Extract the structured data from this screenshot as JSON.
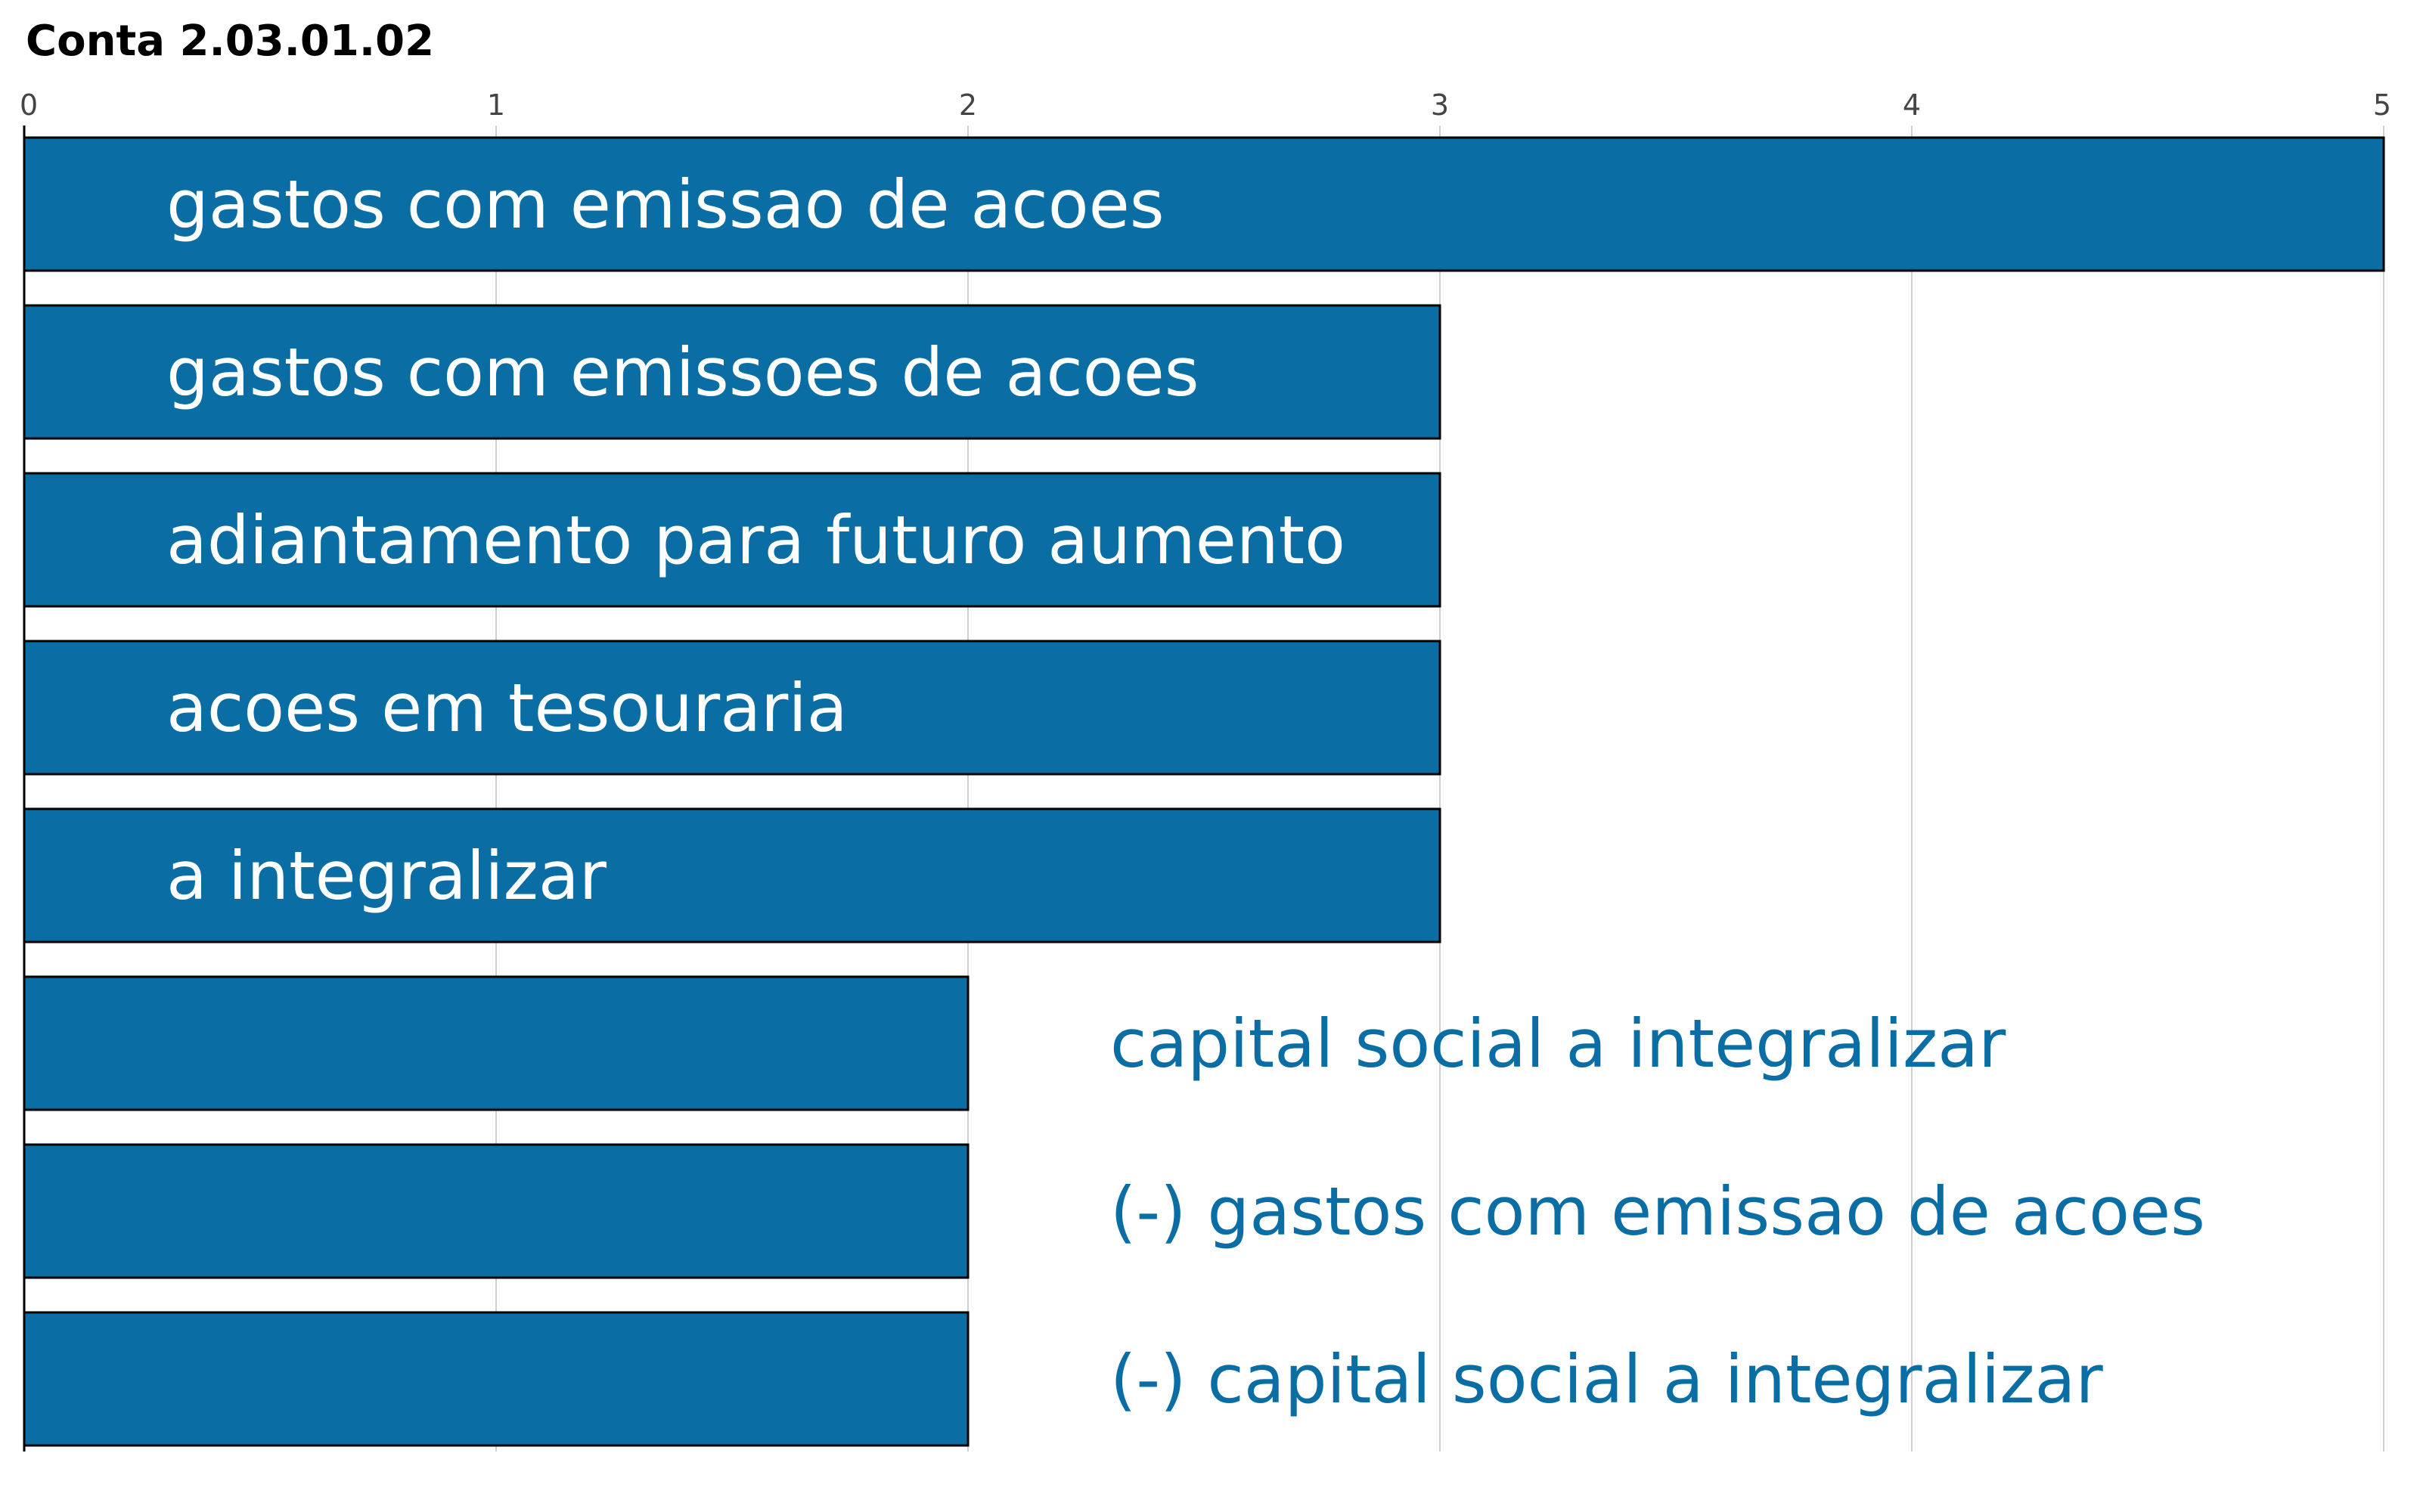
{
  "chart_data": {
    "type": "bar",
    "orientation": "horizontal",
    "title": "Conta 2.03.01.02",
    "xlabel": "",
    "ylabel": "",
    "xlim": [
      0,
      5
    ],
    "x_ticks": [
      0,
      1,
      2,
      3,
      4,
      5
    ],
    "grid": "vertical",
    "categories": [
      "gastos com emissao de acoes",
      "gastos com emissoes de acoes",
      "adiantamento para futuro aumento",
      "acoes em tesouraria",
      "a integralizar",
      "capital social a integralizar",
      "(-) gastos com emissao de acoes",
      "(-) capital social a integralizar"
    ],
    "values": [
      5,
      3,
      3,
      3,
      3,
      2,
      2,
      2
    ],
    "colors": {
      "bar": "#0a6ea4",
      "bar_border": "#000000",
      "label_inside": "#ffffff",
      "label_outside": "#0a6ea4",
      "grid": "#d0d0d0",
      "axis": "#000000",
      "tick_text": "#444444"
    }
  }
}
